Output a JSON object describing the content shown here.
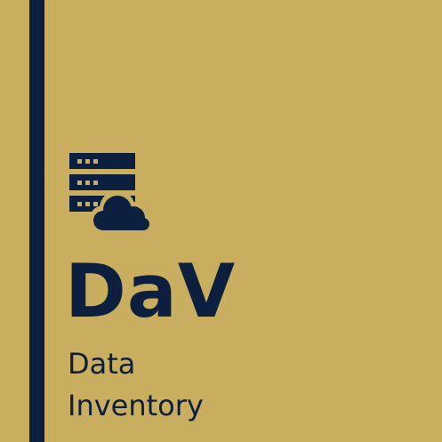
{
  "brand": {
    "acronym": "DaV",
    "subtitle_line_1": "Data",
    "subtitle_line_2": "Inventory",
    "icon": "server-cloud-icon"
  },
  "colors": {
    "background": "#c8ae5e",
    "foreground": "#0d1f3f"
  }
}
